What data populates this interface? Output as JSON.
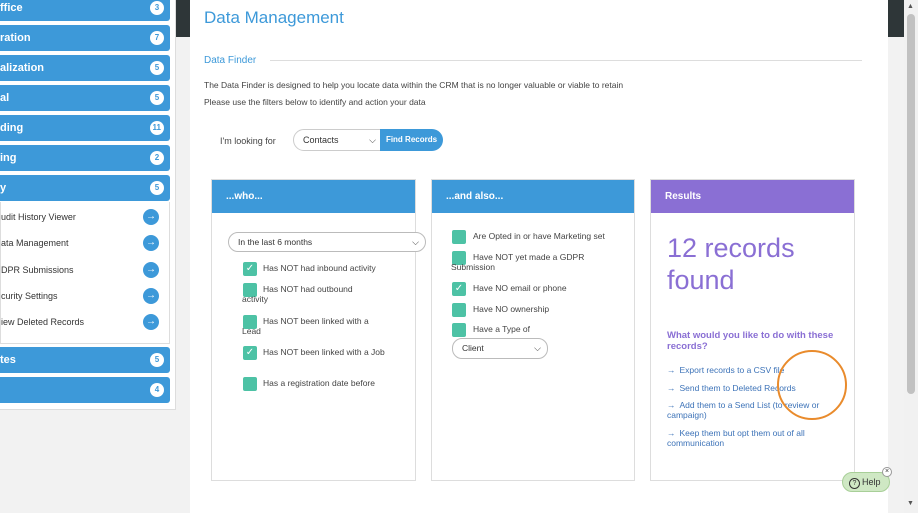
{
  "sidebar": {
    "menus": [
      {
        "label": "ffice",
        "count": "3"
      },
      {
        "label": "ration",
        "count": "7"
      },
      {
        "label": "alization",
        "count": "5"
      },
      {
        "label": "al",
        "count": "5"
      },
      {
        "label": "ding",
        "count": "11"
      },
      {
        "label": "ing",
        "count": "2"
      },
      {
        "label": "y",
        "count": "5"
      },
      {
        "label": "tes",
        "count": "5"
      },
      {
        "label": "",
        "count": "4"
      }
    ],
    "sub_items": [
      {
        "label": "udit History Viewer"
      },
      {
        "label": "ata Management"
      },
      {
        "label": "DPR Submissions"
      },
      {
        "label": "curity Settings"
      },
      {
        "label": "iew Deleted Records"
      }
    ],
    "arrow_glyph": "→"
  },
  "page": {
    "title": "Data Management",
    "section": "Data Finder",
    "intro_line1": "The Data Finder is designed to help you locate data within the CRM that is no longer valuable or viable to retain",
    "intro_line2": "Please use the filters below to identify and action your data"
  },
  "search": {
    "label": "I'm looking for",
    "type_value": "Contacts",
    "button": "Find Records"
  },
  "who": {
    "title": "...who...",
    "range_value": "In the last 6 months",
    "conditions": [
      {
        "label": "Has NOT had inbound activity",
        "checked": true
      },
      {
        "label": "Has NOT had outbound activity",
        "checked": false
      },
      {
        "label": "Has NOT been linked with a Lead",
        "checked": false
      },
      {
        "label": "Has NOT been linked with a Job",
        "checked": true
      },
      {
        "label": "Has a registration date before",
        "checked": false
      }
    ]
  },
  "also": {
    "title": "...and also...",
    "conditions": [
      {
        "label": "Are Opted in or have Marketing set",
        "checked": false
      },
      {
        "label": "Have NOT yet made a GDPR Submission",
        "checked": false
      },
      {
        "label": "Have NO email or phone",
        "checked": true
      },
      {
        "label": "Have NO ownership",
        "checked": false
      },
      {
        "label": "Have a Type of",
        "checked": false
      }
    ],
    "type_value": "Client"
  },
  "results": {
    "title": "Results",
    "count_line1": "12 records",
    "count_line2": "found",
    "question": "What would you like to do with these records?",
    "actions": [
      "Export records to a CSV file",
      "Send them to Deleted Records",
      "Add them to a Send List (to review or campaign)",
      "Keep them but opt them out of all communication"
    ],
    "action_arrow": "→"
  },
  "help": {
    "label": "Help",
    "q": "?",
    "close": "×"
  },
  "scroll": {
    "up": "▲",
    "down": "▼"
  },
  "colors": {
    "accent": "#3d99d9",
    "results": "#8a6fd4",
    "check": "#4dc2a5",
    "highlight": "#e98b2c"
  }
}
